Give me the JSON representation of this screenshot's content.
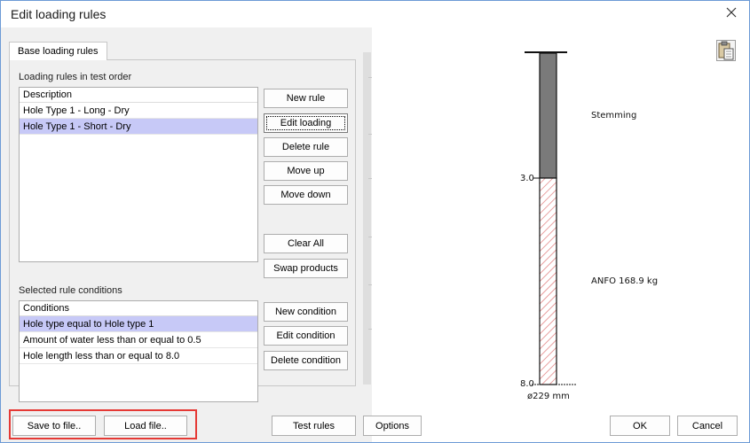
{
  "window": {
    "title": "Edit loading rules"
  },
  "tabs": [
    {
      "label": "Base loading rules"
    }
  ],
  "rules_section": {
    "group_label": "Loading rules in test order",
    "column_header": "Description",
    "rows": [
      "Hole Type 1 - Long - Dry",
      "Hole Type 1 - Short - Dry"
    ],
    "selected_index": 1,
    "buttons": {
      "new_rule": "New rule",
      "edit_loading": "Edit loading",
      "delete_rule": "Delete rule",
      "move_up": "Move up",
      "move_down": "Move down",
      "clear_all": "Clear All",
      "swap_products": "Swap products"
    }
  },
  "conditions_section": {
    "group_label": "Selected rule conditions",
    "column_header": "Conditions",
    "rows": [
      "Hole type equal to Hole type 1",
      "Amount of water less than or equal to 0.5",
      "Hole length less than or equal to 8.0"
    ],
    "selected_index": 0,
    "buttons": {
      "new_condition": "New condition",
      "edit_condition": "Edit condition",
      "delete_condition": "Delete condition"
    }
  },
  "diagram": {
    "stemming_label": "Stemming",
    "product_label": "ANFO 168.9 kg",
    "depth_top": "3.0",
    "depth_bottom": "8.0",
    "diameter": "ø229 mm",
    "stemming_color": "#7a7a7a",
    "product_hatch_color": "#e07a7a"
  },
  "footer": {
    "save_to_file": "Save to file..",
    "load_file": "Load file..",
    "test_rules": "Test rules",
    "options": "Options",
    "ok": "OK",
    "cancel": "Cancel"
  },
  "icons": {
    "close": "close-icon",
    "paste": "paste-icon"
  },
  "colors": {
    "selection": "#c7c9f7",
    "annotation": "#e53935"
  }
}
